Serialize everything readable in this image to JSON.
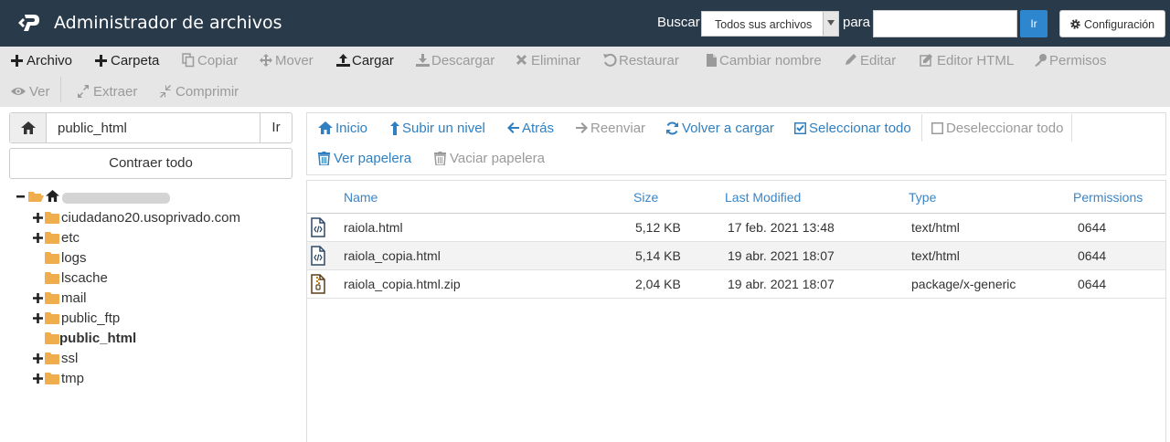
{
  "header": {
    "title": "Administrador de archivos",
    "search_label": "Buscar",
    "search_scope": "Todos sus archivos",
    "para_label": "para",
    "search_value": "",
    "go_label": "Ir",
    "config_label": "Configuración"
  },
  "toolbar": {
    "archivo": "Archivo",
    "carpeta": "Carpeta",
    "copiar": "Copiar",
    "mover": "Mover",
    "cargar": "Cargar",
    "descargar": "Descargar",
    "eliminar": "Eliminar",
    "restaurar": "Restaurar",
    "cambiar_nombre": "Cambiar nombre",
    "editar": "Editar",
    "editor_html": "Editor HTML",
    "permisos": "Permisos",
    "ver": "Ver",
    "extraer": "Extraer",
    "comprimir": "Comprimir"
  },
  "path_bar": {
    "value": "public_html",
    "go_label": "Ir",
    "collapse_label": "Contraer todo"
  },
  "tree": {
    "items": [
      {
        "label": "ciudadano20.usoprivado.com",
        "toggle": "+"
      },
      {
        "label": "etc",
        "toggle": "+"
      },
      {
        "label": "logs",
        "toggle": ""
      },
      {
        "label": "lscache",
        "toggle": ""
      },
      {
        "label": "mail",
        "toggle": "+"
      },
      {
        "label": "public_ftp",
        "toggle": "+"
      },
      {
        "label": "public_html",
        "toggle": ""
      },
      {
        "label": "ssl",
        "toggle": "+"
      },
      {
        "label": "tmp",
        "toggle": "+"
      }
    ]
  },
  "nav": {
    "inicio": "Inicio",
    "subir": "Subir un nivel",
    "atras": "Atrás",
    "reenviar": "Reenviar",
    "volver": "Volver a cargar",
    "seleccionar": "Seleccionar todo",
    "deseleccionar": "Deseleccionar todo",
    "ver_papelera": "Ver papelera",
    "vaciar_papelera": "Vaciar papelera"
  },
  "files": {
    "columns": [
      "Name",
      "Size",
      "Last Modified",
      "Type",
      "Permissions"
    ],
    "rows": [
      {
        "name": "raiola.html",
        "size": "5,12 KB",
        "modified": "17 feb. 2021 13:48",
        "type": "text/html",
        "perms": "0644"
      },
      {
        "name": "raiola_copia.html",
        "size": "5,14 KB",
        "modified": "19 abr. 2021 18:07",
        "type": "text/html",
        "perms": "0644"
      },
      {
        "name": "raiola_copia.html.zip",
        "size": "2,04 KB",
        "modified": "19 abr. 2021 18:07",
        "type": "package/x-generic",
        "perms": "0644"
      }
    ]
  },
  "colors": {
    "header_bg": "#293a4a",
    "toolbar_bg": "#e6e6e6",
    "link_blue": "#2f7fc1",
    "folder": "#f0ad4e"
  }
}
